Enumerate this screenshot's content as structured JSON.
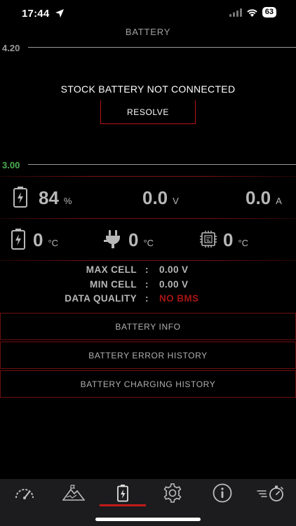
{
  "status_bar": {
    "time": "17:44",
    "battery_level": "63"
  },
  "header": {
    "title": "BATTERY"
  },
  "graph": {
    "max_label": "4.20",
    "min_label": "3.00"
  },
  "notice": {
    "text": "STOCK BATTERY NOT CONNECTED",
    "resolve_label": "RESOLVE"
  },
  "metrics": {
    "charge": {
      "value": "84",
      "unit": "%"
    },
    "voltage": {
      "value": "0.0",
      "unit": "V"
    },
    "current": {
      "value": "0.0",
      "unit": "A"
    },
    "battery_temp": {
      "value": "0",
      "unit": "°C"
    },
    "charger_temp": {
      "value": "0",
      "unit": "°C"
    },
    "controller_temp": {
      "value": "0",
      "unit": "°C"
    }
  },
  "cells": {
    "max_label": "MAX CELL",
    "max_value": "0.00  V",
    "min_label": "MIN CELL",
    "min_value": "0.00  V",
    "quality_label": "DATA QUALITY",
    "quality_value": "NO BMS",
    "separator": ":"
  },
  "menu": [
    {
      "label": "BATTERY INFO"
    },
    {
      "label": "BATTERY ERROR HISTORY"
    },
    {
      "label": "BATTERY CHARGING HISTORY"
    }
  ],
  "tabs": [
    "speedometer-icon",
    "mountain-icon",
    "battery-icon",
    "gear-icon",
    "info-icon",
    "stopwatch-icon"
  ],
  "colors": {
    "accent_red": "#c41919",
    "text_grey": "#b8b8b8",
    "green": "#4caf50"
  }
}
